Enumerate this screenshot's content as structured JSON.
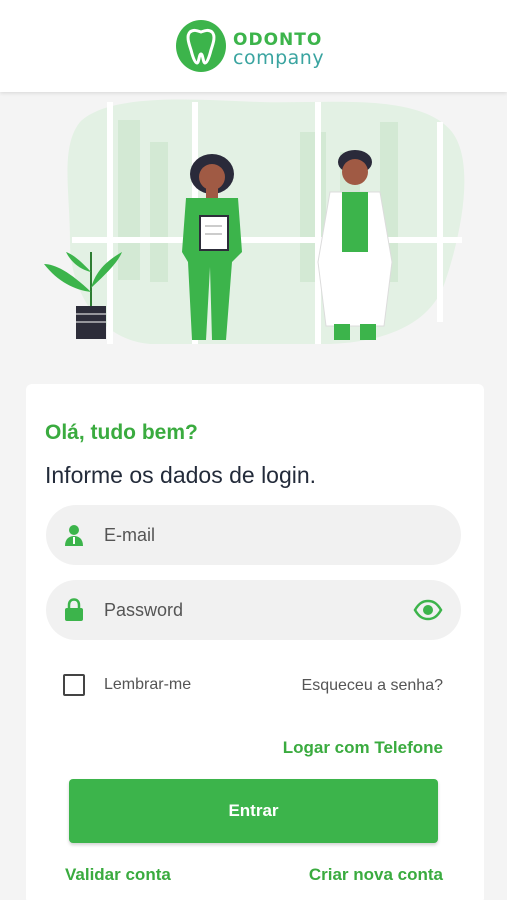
{
  "brand": {
    "line1": "ODONTO",
    "line2": "company"
  },
  "login": {
    "greeting": "Olá, tudo bem?",
    "subtitle": "Informe os dados de login.",
    "email_placeholder": "E-mail",
    "password_placeholder": "Password",
    "remember_label": "Lembrar-me",
    "forgot_label": "Esqueceu a senha?",
    "phone_login_label": "Logar com Telefone",
    "enter_label": "Entrar",
    "validate_label": "Validar conta",
    "create_label": "Criar nova conta",
    "remember_checked": false
  },
  "colors": {
    "accent": "#3cb44b",
    "accent_text": "#3aab3f",
    "text_dark": "#232b3a"
  },
  "icons": [
    "tooth-logo-icon",
    "user-icon",
    "lock-icon",
    "eye-icon",
    "plant-icon"
  ]
}
